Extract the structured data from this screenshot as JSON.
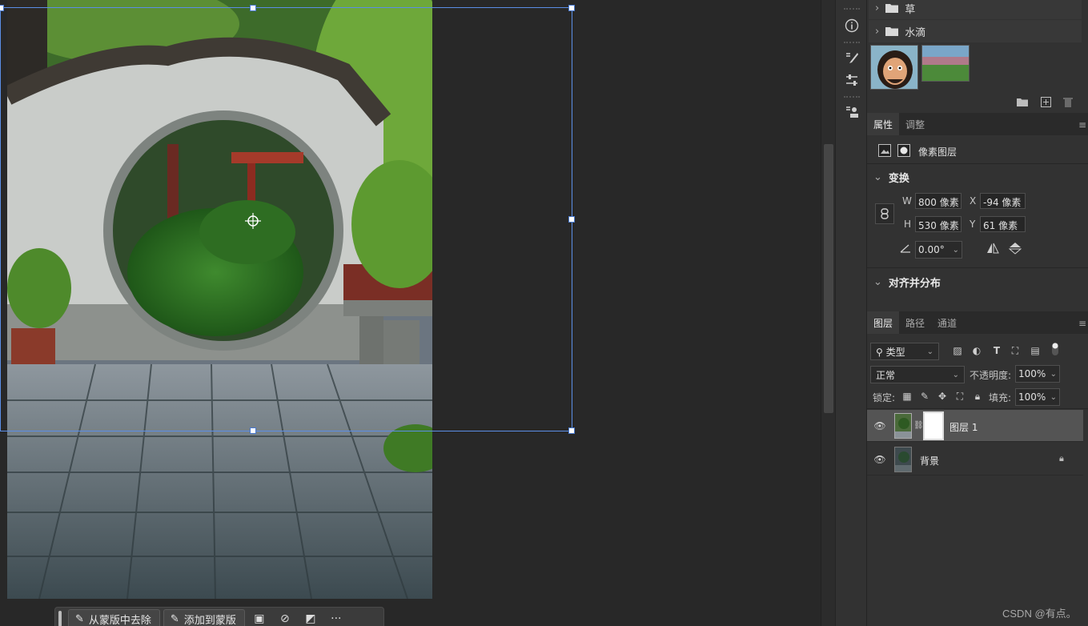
{
  "library": {
    "folders": [
      {
        "label": "草"
      },
      {
        "label": "水滴"
      }
    ]
  },
  "properties": {
    "tabs": [
      "属性",
      "调整"
    ],
    "layer_type_label": "像素图层",
    "transform": {
      "heading": "变换",
      "w_label": "W",
      "w_value": "800 像素",
      "h_label": "H",
      "h_value": "530 像素",
      "x_label": "X",
      "x_value": "-94 像素",
      "y_label": "Y",
      "y_value": "61 像素",
      "angle_value": "0.00°"
    },
    "align_heading": "对齐并分布"
  },
  "layers_panel": {
    "tabs": [
      "图层",
      "路径",
      "通道"
    ],
    "filter_kind": "类型",
    "blend_mode": "正常",
    "opacity_label": "不透明度:",
    "opacity_value": "100%",
    "lock_label": "锁定:",
    "fill_label": "填充:",
    "fill_value": "100%",
    "layers": [
      {
        "name": "图层 1"
      },
      {
        "name": "背景"
      }
    ]
  },
  "mask_bar": {
    "subtract_label": "从蒙版中去除",
    "add_label": "添加到蒙版",
    "more_label": "···"
  },
  "watermark": "CSDN @有点。",
  "colors": {
    "selection": "#5b8ee6",
    "panel_bg": "#323232",
    "canvas_bg": "#282828",
    "selected_layer": "#545454"
  }
}
